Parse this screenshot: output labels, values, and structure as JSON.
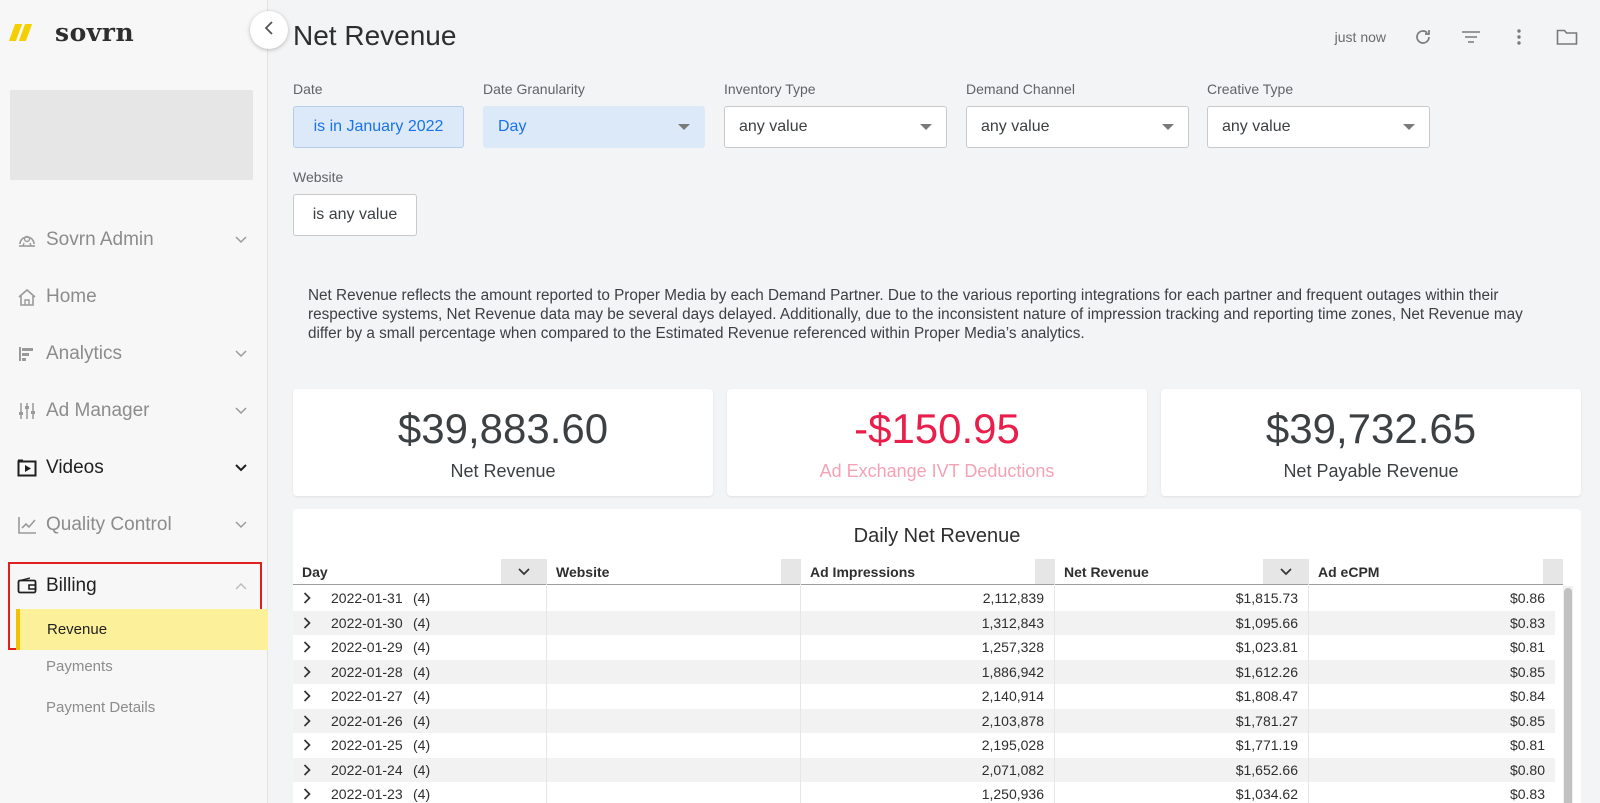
{
  "brand": {
    "name": "sovrn",
    "accent": "#f5d000"
  },
  "sidebar": {
    "items": [
      {
        "label": "Sovrn Admin",
        "icon": "admin-dashboard-icon",
        "chevron": "down"
      },
      {
        "label": "Home",
        "icon": "home-icon",
        "chevron": ""
      },
      {
        "label": "Analytics",
        "icon": "analytics-icon",
        "chevron": "down"
      },
      {
        "label": "Ad Manager",
        "icon": "sliders-icon",
        "chevron": "down"
      },
      {
        "label": "Videos",
        "icon": "video-icon",
        "chevron": "down"
      },
      {
        "label": "Quality Control",
        "icon": "chart-line-icon",
        "chevron": "down"
      },
      {
        "label": "Billing",
        "icon": "wallet-icon",
        "chevron": "up"
      }
    ],
    "billing_sub": {
      "active": "Revenue",
      "items": [
        "Payments",
        "Payment Details"
      ]
    }
  },
  "header": {
    "title": "Net Revenue",
    "updated": "just now"
  },
  "filters": {
    "date": {
      "label": "Date",
      "value": "is in January 2022"
    },
    "granularity": {
      "label": "Date Granularity",
      "value": "Day"
    },
    "inventory": {
      "label": "Inventory Type",
      "value": "any value"
    },
    "demand": {
      "label": "Demand Channel",
      "value": "any value"
    },
    "creative": {
      "label": "Creative Type",
      "value": "any value"
    },
    "website": {
      "label": "Website",
      "value": "is any value"
    }
  },
  "notice": "Net Revenue reflects the amount reported to Proper Media by each Demand Partner. Due to the various reporting integrations for each partner and frequent outages within their respective systems, Net Revenue data may be several days delayed. Additionally, due to the inconsistent nature of impression tracking and reporting time zones, Net Revenue may differ by a small percentage when compared to the Estimated Revenue referenced within Proper Media’s analytics.",
  "kpis": [
    {
      "value": "$39,883.60",
      "label": "Net Revenue"
    },
    {
      "value": "-$150.95",
      "label": "Ad Exchange IVT Deductions",
      "color": "#ea1e4b"
    },
    {
      "value": "$39,732.65",
      "label": "Net Payable Revenue"
    }
  ],
  "table": {
    "title": "Daily Net Revenue",
    "columns": [
      "Day",
      "Website",
      "Ad Impressions",
      "Net Revenue",
      "Ad eCPM"
    ],
    "rows": [
      {
        "day": "2022-01-31",
        "count": "(4)",
        "website": "",
        "impressions": "2,112,839",
        "revenue": "$1,815.73",
        "ecpm": "$0.86"
      },
      {
        "day": "2022-01-30",
        "count": "(4)",
        "website": "",
        "impressions": "1,312,843",
        "revenue": "$1,095.66",
        "ecpm": "$0.83"
      },
      {
        "day": "2022-01-29",
        "count": "(4)",
        "website": "",
        "impressions": "1,257,328",
        "revenue": "$1,023.81",
        "ecpm": "$0.81"
      },
      {
        "day": "2022-01-28",
        "count": "(4)",
        "website": "",
        "impressions": "1,886,942",
        "revenue": "$1,612.26",
        "ecpm": "$0.85"
      },
      {
        "day": "2022-01-27",
        "count": "(4)",
        "website": "",
        "impressions": "2,140,914",
        "revenue": "$1,808.47",
        "ecpm": "$0.84"
      },
      {
        "day": "2022-01-26",
        "count": "(4)",
        "website": "",
        "impressions": "2,103,878",
        "revenue": "$1,781.27",
        "ecpm": "$0.85"
      },
      {
        "day": "2022-01-25",
        "count": "(4)",
        "website": "",
        "impressions": "2,195,028",
        "revenue": "$1,771.19",
        "ecpm": "$0.81"
      },
      {
        "day": "2022-01-24",
        "count": "(4)",
        "website": "",
        "impressions": "2,071,082",
        "revenue": "$1,652.66",
        "ecpm": "$0.80"
      },
      {
        "day": "2022-01-23",
        "count": "(4)",
        "website": "",
        "impressions": "1,250,936",
        "revenue": "$1,034.62",
        "ecpm": "$0.83"
      }
    ]
  }
}
